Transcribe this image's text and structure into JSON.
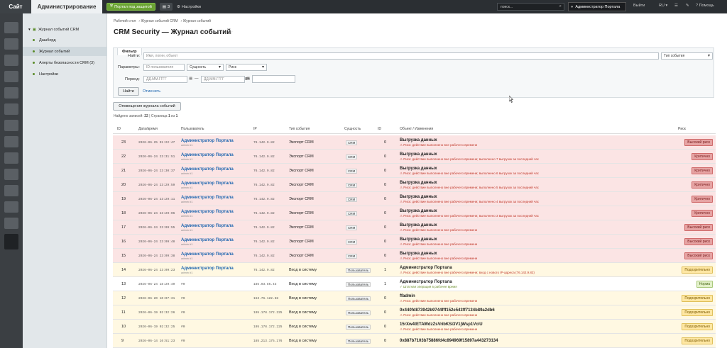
{
  "topbar": {
    "site": "Сайт",
    "admin": "Администрирование",
    "protected": "Портал под защитой",
    "counter": "3",
    "settings": "Настройки",
    "search_placeholder": "поиск...",
    "user": "Администратор Портала",
    "logout": "Выйти",
    "lang": "RU",
    "help": "Помощь"
  },
  "sidebar": {
    "root": "Журнал событий CRM",
    "items": [
      "Дашборд",
      "Журнал событий",
      "Алерты безопасности CRM (3)",
      "Настройки"
    ],
    "active_index": 1
  },
  "breadcrumb": [
    "Рабочий стол",
    "Журнал событий CRM",
    "Журнал событий"
  ],
  "page_title": "CRM Security — Журнал событий",
  "filter": {
    "tab": "Фильтр",
    "find_label": "Найти:",
    "find_placeholder": "Имя, логин, объект",
    "event_type": "Тип события",
    "params_label": "Параметры:",
    "user_id_placeholder": "ID пользователя",
    "entity": "Сущность",
    "risk": "Риск",
    "period_label": "Период:",
    "date_placeholder": "ДД.ММ.ГГГГ",
    "dash": "—",
    "ip_label": "IP:",
    "find_button": "Найти",
    "reset": "Отменить"
  },
  "notify_button": "Оповещения журнала событий",
  "summary": {
    "found_label": "Найдено записей:",
    "found": "22",
    "page_label": "| Страница",
    "page": "1",
    "of": "из",
    "pages": "1"
  },
  "columns": [
    "ID",
    "Дата/время",
    "Пользователь",
    "IP",
    "Тип события",
    "Сущность",
    "ID",
    "Объект / Изменения",
    "Риск"
  ],
  "rows": [
    {
      "id": "23",
      "dt": "2026-06-25 01:22:47",
      "user": "Администратор Портала",
      "login": "admin #1",
      "ip": "76.142.9.82",
      "type": "Экспорт CRM",
      "entity": "CRM",
      "eid": "0",
      "obj": "Выгрузка данных",
      "note": "⚠ Риск: действие выполнено вне рабочего времени",
      "risk": "Высокий риск",
      "level": "high"
    },
    {
      "id": "22",
      "dt": "2026-06-24 23:31:51",
      "user": "Администратор Портала",
      "login": "admin #1",
      "ip": "76.142.9.82",
      "type": "Экспорт CRM",
      "entity": "CRM",
      "eid": "0",
      "obj": "Выгрузка данных",
      "note": "⚠ Риск: действие выполнено вне рабочего времени; выполнено 7 выгрузок за последний час",
      "risk": "Критично",
      "level": "crit"
    },
    {
      "id": "21",
      "dt": "2026-06-24 23:30:37",
      "user": "Администратор Портала",
      "login": "admin #1",
      "ip": "76.142.9.82",
      "type": "Экспорт CRM",
      "entity": "CRM",
      "eid": "0",
      "obj": "Выгрузка данных",
      "note": "⚠ Риск: действие выполнено вне рабочего времени; выполнено 6 выгрузок за последний час",
      "risk": "Критично",
      "level": "crit"
    },
    {
      "id": "20",
      "dt": "2026-06-24 23:29:59",
      "user": "Администратор Портала",
      "login": "admin #1",
      "ip": "76.142.9.82",
      "type": "Экспорт CRM",
      "entity": "CRM",
      "eid": "0",
      "obj": "Выгрузка данных",
      "note": "⚠ Риск: действие выполнено вне рабочего времени; выполнено 5 выгрузок за последний час",
      "risk": "Критично",
      "level": "crit"
    },
    {
      "id": "19",
      "dt": "2026-06-24 23:29:11",
      "user": "Администратор Портала",
      "login": "admin #1",
      "ip": "76.142.9.82",
      "type": "Экспорт CRM",
      "entity": "CRM",
      "eid": "0",
      "obj": "Выгрузка данных",
      "note": "⚠ Риск: действие выполнено вне рабочего времени; выполнено 4 выгрузок за последний час",
      "risk": "Критично",
      "level": "crit"
    },
    {
      "id": "18",
      "dt": "2026-06-24 23:29:06",
      "user": "Администратор Портала",
      "login": "admin #1",
      "ip": "76.142.9.82",
      "type": "Экспорт CRM",
      "entity": "CRM",
      "eid": "0",
      "obj": "Выгрузка данных",
      "note": "⚠ Риск: действие выполнено вне рабочего времени; выполнено 3 выгрузок за последний час",
      "risk": "Критично",
      "level": "crit"
    },
    {
      "id": "17",
      "dt": "2026-06-24 23:09:55",
      "user": "Администратор Портала",
      "login": "admin #1",
      "ip": "76.142.9.82",
      "type": "Экспорт CRM",
      "entity": "CRM",
      "eid": "0",
      "obj": "Выгрузка данных",
      "note": "⚠ Риск: действие выполнено вне рабочего времени",
      "risk": "Высокий риск",
      "level": "high"
    },
    {
      "id": "16",
      "dt": "2026-06-24 23:09:48",
      "user": "Администратор Портала",
      "login": "admin #1",
      "ip": "76.142.9.82",
      "type": "Экспорт CRM",
      "entity": "CRM",
      "eid": "0",
      "obj": "Выгрузка данных",
      "note": "⚠ Риск: действие выполнено вне рабочего времени",
      "risk": "Высокий риск",
      "level": "high"
    },
    {
      "id": "15",
      "dt": "2026-06-24 23:09:38",
      "user": "Администратор Портала",
      "login": "admin #1",
      "ip": "76.142.9.82",
      "type": "Экспорт CRM",
      "entity": "CRM",
      "eid": "0",
      "obj": "Выгрузка данных",
      "note": "⚠ Риск: действие выполнено вне рабочего времени",
      "risk": "Высокий риск",
      "level": "high"
    },
    {
      "id": "14",
      "dt": "2026-06-24 23:09:23",
      "user": "Администратор Портала",
      "login": "admin #1",
      "ip": "76.142.9.82",
      "type": "Вход в систему",
      "entity": "Пользователь",
      "eid": "1",
      "obj": "Администратор Портала",
      "note": "⚠ Риск: действие выполнено вне рабочего времени; вход с нового IP-адреса (76.142.9.82)",
      "risk": "Подозрительно",
      "level": "susp"
    },
    {
      "id": "13",
      "dt": "2026-06-24 18:29:49",
      "user": "",
      "login": "#0",
      "ip": "185.93.85.43",
      "type": "Вход в систему",
      "entity": "Пользователь",
      "eid": "1",
      "obj": "Администратор Портала",
      "note": "✓ Штатная операция в рабочее время",
      "risk": "Норма",
      "level": "norm"
    },
    {
      "id": "12",
      "dt": "2026-06-20 10:07:31",
      "user": "",
      "login": "#0",
      "ip": "153.76.122.88",
      "type": "Вход в систему",
      "entity": "Пользователь",
      "eid": "0",
      "obj": "ffadmin",
      "note": "⚠ Риск: действие выполнено вне рабочего времени",
      "risk": "Подозрительно",
      "level": "susp"
    },
    {
      "id": "11",
      "dt": "2026-06-19 02:32:26",
      "user": "",
      "login": "#0",
      "ip": "195.178.172.225",
      "type": "Вход в систему",
      "entity": "Пользователь",
      "eid": "0",
      "obj": "0x440fd873942b9744fff152e543ff7134b89a2db6",
      "note": "⚠ Риск: действие выполнено вне рабочего времени",
      "risk": "Подозрительно",
      "level": "susp"
    },
    {
      "id": "10",
      "dt": "2026-06-19 02:32:25",
      "user": "",
      "login": "#0",
      "ip": "195.178.172.225",
      "type": "Вход в систему",
      "entity": "Пользователь",
      "eid": "0",
      "obj": "15rXw4tETAWdzZsVribKSi3V1jWsp1VciU",
      "note": "⚠ Риск: действие выполнено вне рабочего времени",
      "risk": "Подозрительно",
      "level": "susp"
    },
    {
      "id": "9",
      "dt": "2026-06-14 16:51:23",
      "user": "",
      "login": "#0",
      "ip": "185.213.175.176",
      "type": "Вход в систему",
      "entity": "Пользователь",
      "eid": "0",
      "obj": "0x887b7103b75886fd4c894969f15897a443273134",
      "note": "",
      "risk": "Подозрительно",
      "level": "susp"
    }
  ]
}
